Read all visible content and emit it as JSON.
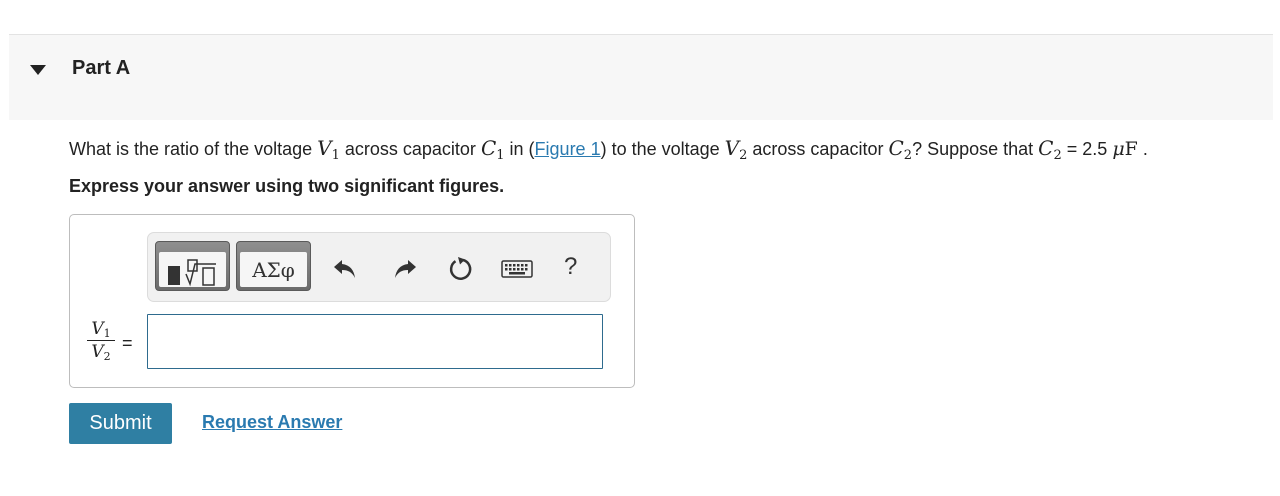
{
  "part": {
    "title": "Part A"
  },
  "question": {
    "t1": "What is the ratio of the voltage ",
    "v1_base": "V",
    "v1_sub": "1",
    "t2": " across capacitor ",
    "c1_base": "C",
    "c1_sub": "1",
    "t3": " in (",
    "figure_link": "Figure 1",
    "t4": ") to the voltage ",
    "v2_base": "V",
    "v2_sub": "2",
    "t5": " across capacitor ",
    "c2_base": "C",
    "c2_sub": "2",
    "t6": "? Suppose that ",
    "c2b_base": "C",
    "c2b_sub": "2",
    "t7": " = 2.5 ",
    "unit_mu": "μ",
    "unit_f": "F",
    "t8": " ."
  },
  "instruction": "Express your answer using two significant figures.",
  "toolbar": {
    "symbols_label": "ΑΣφ",
    "help_label": "?"
  },
  "answer": {
    "lhs_num_base": "V",
    "lhs_num_sub": "1",
    "lhs_den_base": "V",
    "lhs_den_sub": "2",
    "equals": "=",
    "value": ""
  },
  "actions": {
    "submit_label": "Submit",
    "request_label": "Request Answer"
  }
}
